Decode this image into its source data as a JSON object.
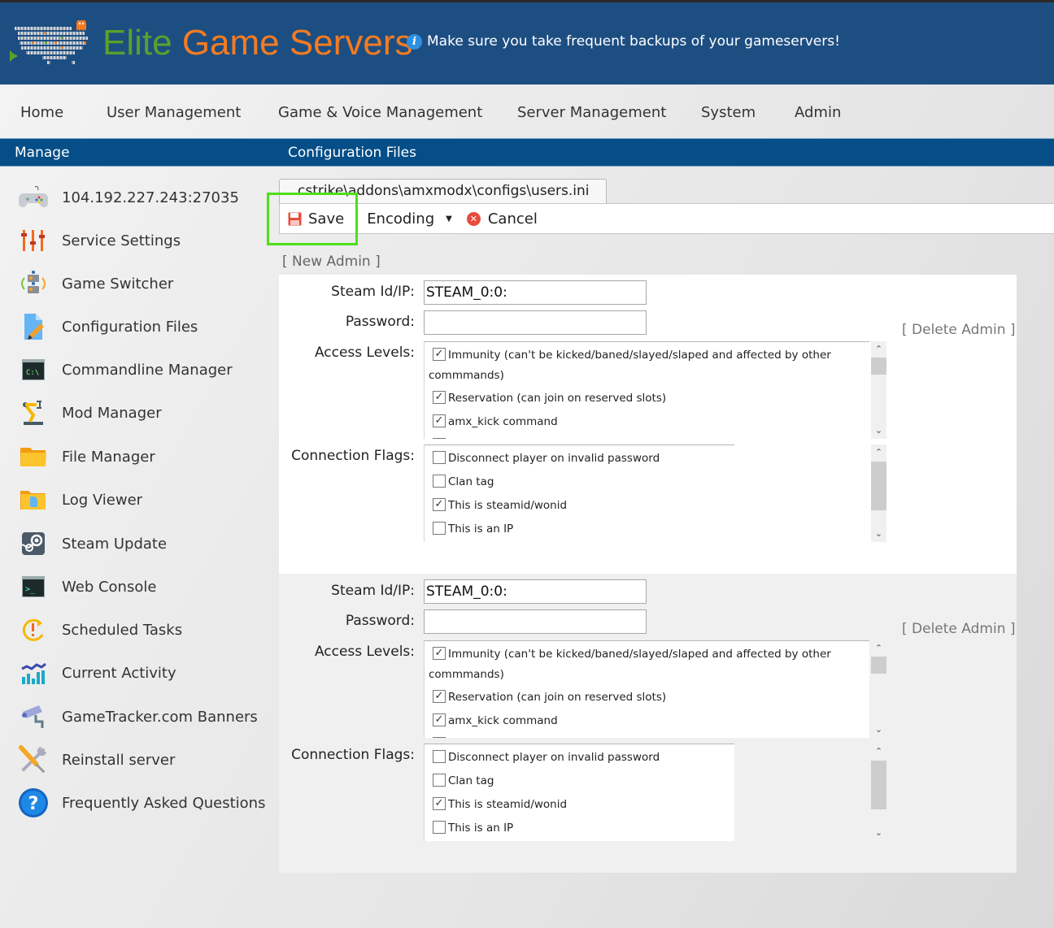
{
  "header": {
    "brand_part1": "Elite",
    "brand_part2": "Game Servers",
    "notice": "Make sure you take frequent backups of your gameservers!",
    "colors": {
      "header_bg": "#1d4e82",
      "elite": "#5aa02c",
      "game_servers": "#f47b20",
      "subbar_bg": "#054e87",
      "highlight": "#4ce01a"
    }
  },
  "topnav": {
    "items": [
      {
        "label": "Home"
      },
      {
        "label": "User Management"
      },
      {
        "label": "Game & Voice Management"
      },
      {
        "label": "Server Management"
      },
      {
        "label": "System"
      },
      {
        "label": "Admin"
      }
    ]
  },
  "subbar": {
    "left": "Manage",
    "right": "Configuration Files"
  },
  "sidebar": {
    "items": [
      {
        "label": "104.192.227.243:27035",
        "icon": "gamepad-icon"
      },
      {
        "label": "Service Settings",
        "icon": "sliders-icon"
      },
      {
        "label": "Game Switcher",
        "icon": "switch-icon"
      },
      {
        "label": "Configuration Files",
        "icon": "file-edit-icon"
      },
      {
        "label": "Commandline Manager",
        "icon": "cmd-icon"
      },
      {
        "label": "Mod Manager",
        "icon": "robot-arm-icon"
      },
      {
        "label": "File Manager",
        "icon": "folder-icon"
      },
      {
        "label": "Log Viewer",
        "icon": "log-folder-icon"
      },
      {
        "label": "Steam Update",
        "icon": "steam-icon"
      },
      {
        "label": "Web Console",
        "icon": "console-icon"
      },
      {
        "label": "Scheduled Tasks",
        "icon": "scheduled-icon"
      },
      {
        "label": "Current Activity",
        "icon": "activity-chart-icon"
      },
      {
        "label": "GameTracker.com Banners",
        "icon": "camera-icon"
      },
      {
        "label": "Reinstall server",
        "icon": "tools-icon"
      },
      {
        "label": "Frequently Asked Questions",
        "icon": "help-icon"
      }
    ]
  },
  "editor": {
    "tab_label": "cstrike\\addons\\amxmodx\\configs\\users.ini",
    "toolbar": {
      "save": "Save",
      "encoding": "Encoding",
      "cancel": "Cancel"
    },
    "new_admin": "[ New Admin ]"
  },
  "labels": {
    "steam_id": "Steam Id/IP:",
    "password": "Password:",
    "access_levels": "Access Levels:",
    "connection_flags": "Connection Flags:",
    "delete_admin": "[ Delete Admin ]"
  },
  "admins": [
    {
      "steam_id": "STEAM_0:0:",
      "password": "",
      "access_levels": [
        {
          "label": "Immunity (can't be kicked/baned/slayed/slaped and affected by other",
          "cont": "commmands)",
          "checked": true
        },
        {
          "label": "Reservation (can join on reserved slots)",
          "checked": true
        },
        {
          "label": "amx_kick command",
          "checked": true
        }
      ],
      "connection_flags": [
        {
          "label": "Disconnect player on invalid password",
          "checked": false
        },
        {
          "label": "Clan tag",
          "checked": false
        },
        {
          "label": "This is steamid/wonid",
          "checked": true
        },
        {
          "label": "This is an IP",
          "checked": false
        }
      ]
    },
    {
      "steam_id": "STEAM_0:0:",
      "password": "",
      "access_levels": [
        {
          "label": "Immunity (can't be kicked/baned/slayed/slaped and affected by other",
          "cont": "commmands)",
          "checked": true
        },
        {
          "label": "Reservation (can join on reserved slots)",
          "checked": true
        },
        {
          "label": "amx_kick command",
          "checked": true
        }
      ],
      "connection_flags": [
        {
          "label": "Disconnect player on invalid password",
          "checked": false
        },
        {
          "label": "Clan tag",
          "checked": false
        },
        {
          "label": "This is steamid/wonid",
          "checked": true
        },
        {
          "label": "This is an IP",
          "checked": false
        }
      ]
    }
  ]
}
